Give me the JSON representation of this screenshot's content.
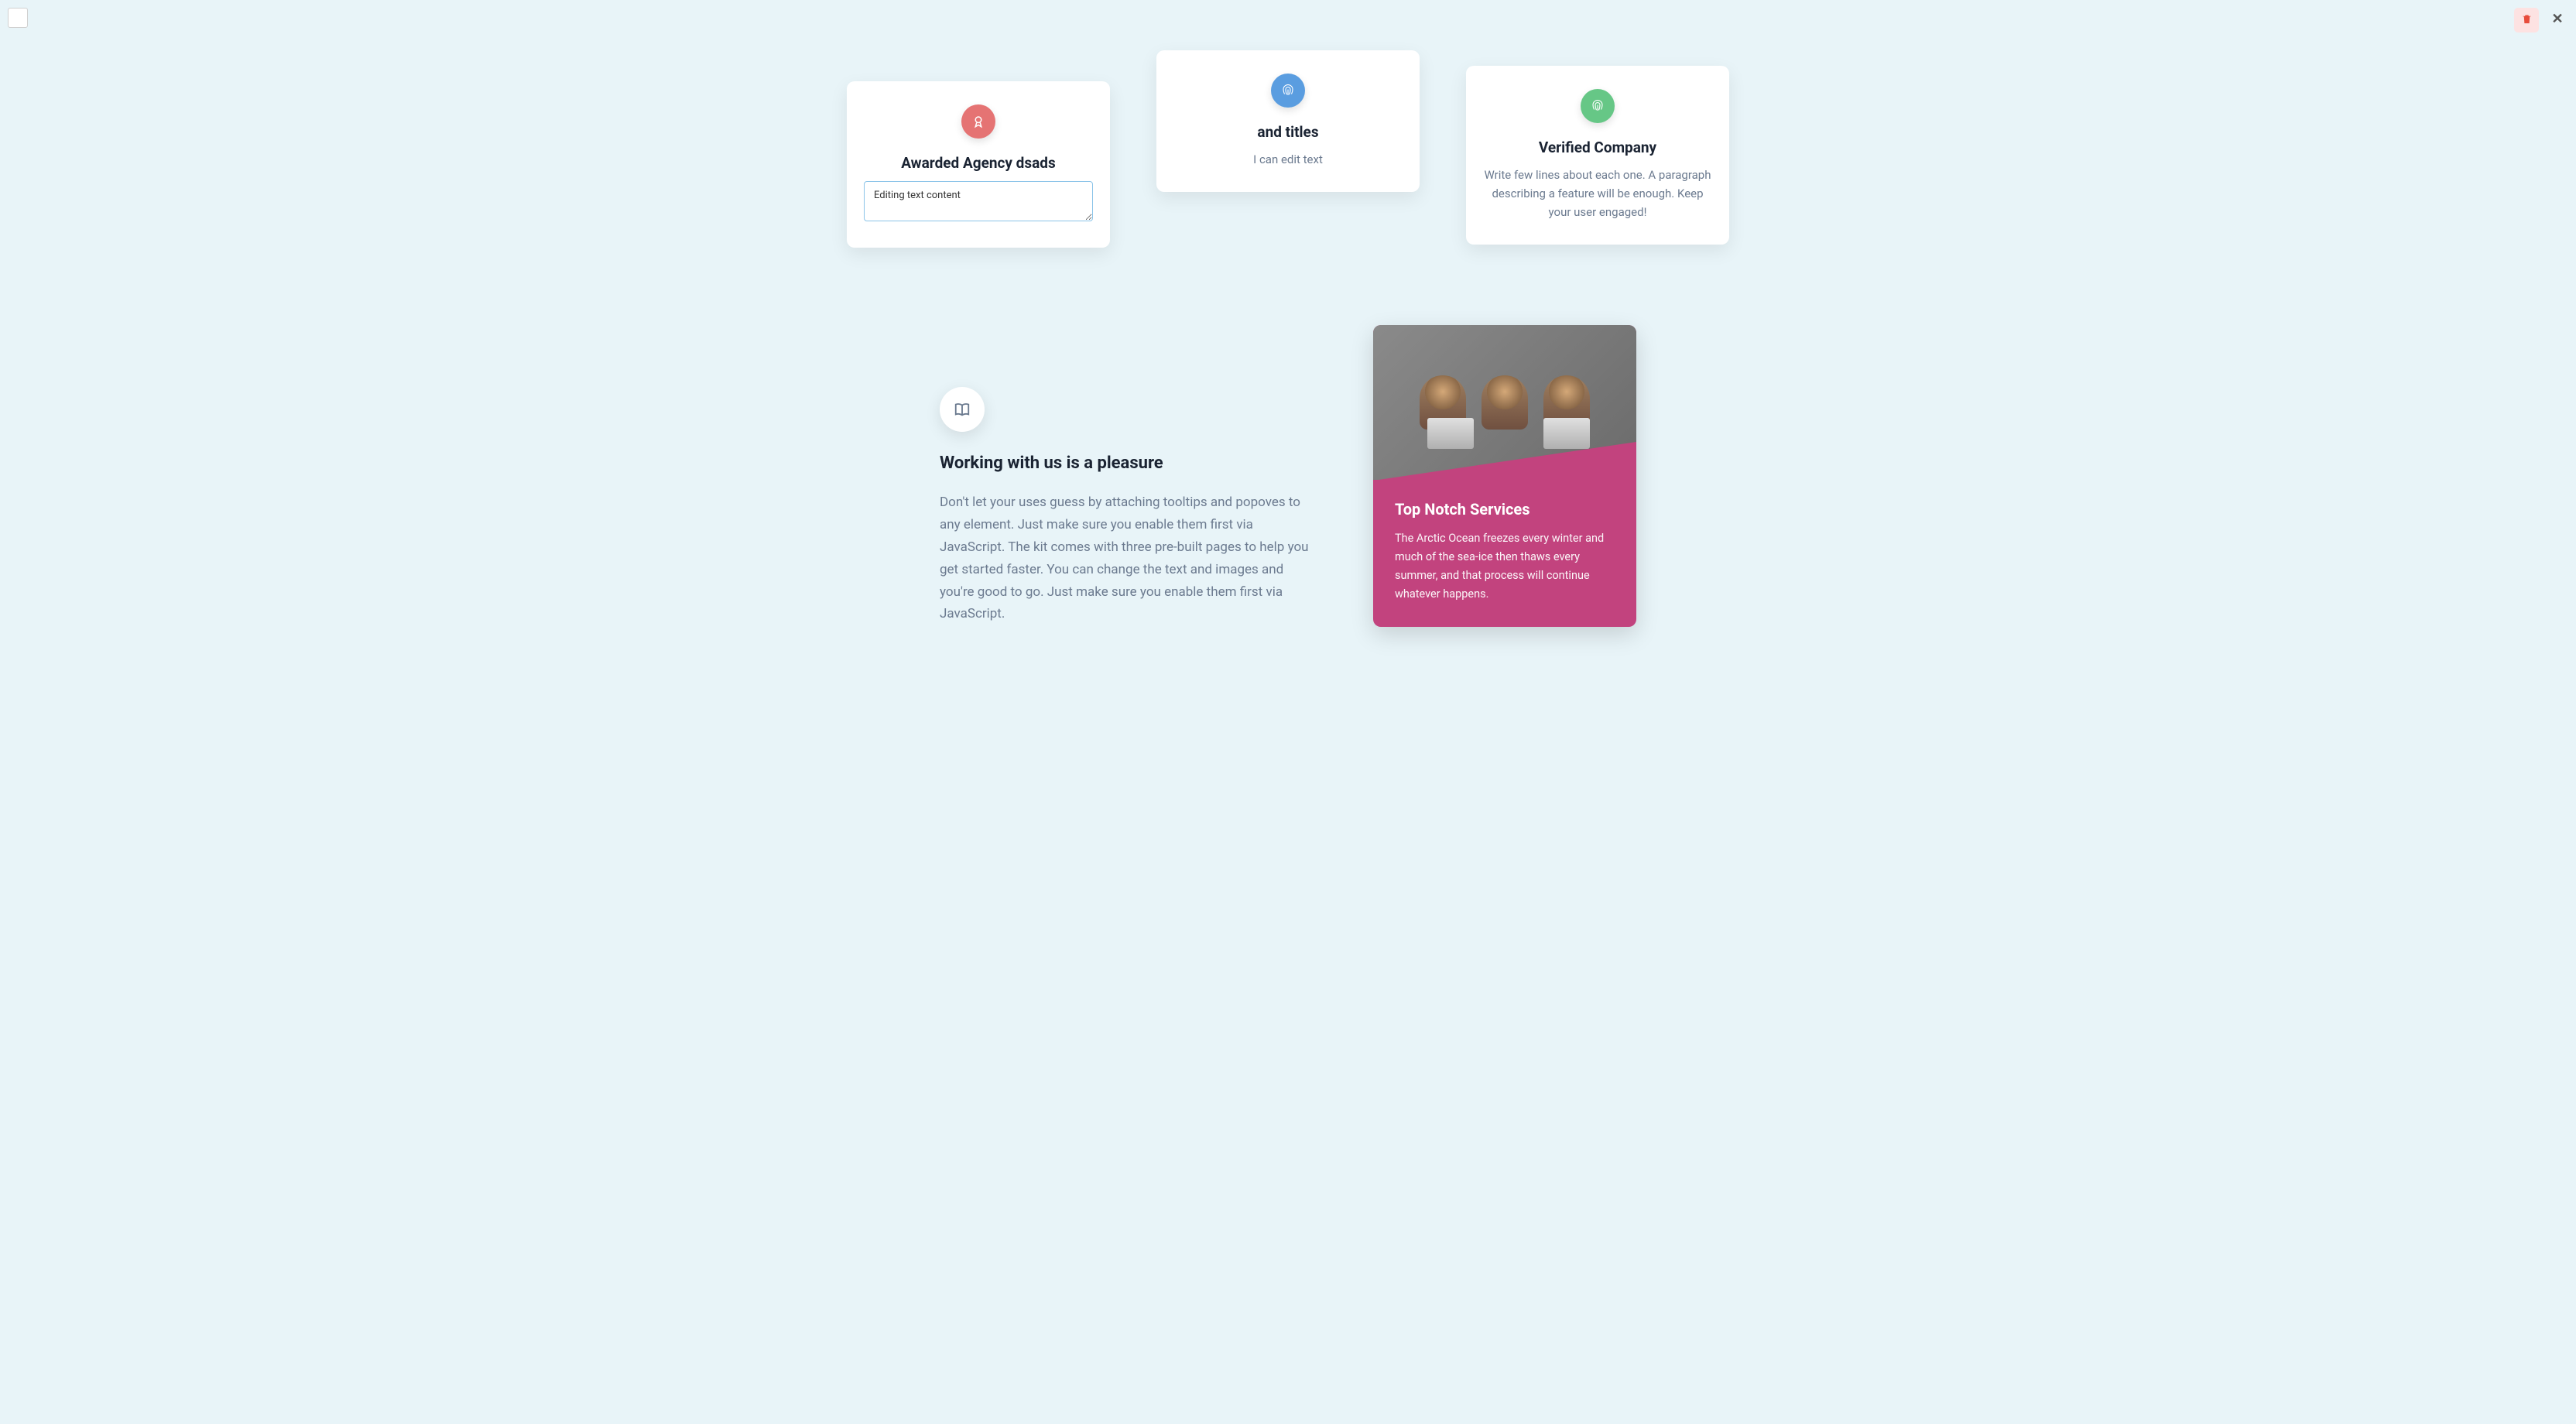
{
  "cards": [
    {
      "title": "Awarded Agency dsads",
      "edit_value": "Editing text content",
      "icon": "award-icon"
    },
    {
      "title": "and titles",
      "body": "I can edit text",
      "icon": "fingerprint-icon"
    },
    {
      "title": "Verified Company",
      "body": "Write few lines about each one. A paragraph describing a feature will be enough. Keep your user engaged!",
      "icon": "fingerprint-icon"
    }
  ],
  "working": {
    "heading": "Working with us is a pleasure",
    "body": "Don't let your uses guess by attaching tooltips and popoves to any element. Just make sure you enable them first via JavaScript. The kit comes with three pre-built pages to help you get started faster. You can change the text and images and you're good to go. Just make sure you enable them first via JavaScript."
  },
  "service": {
    "title": "Top Notch Services",
    "body": "The Arctic Ocean freezes every winter and much of the sea-ice then thaws every summer, and that process will continue whatever happens."
  }
}
